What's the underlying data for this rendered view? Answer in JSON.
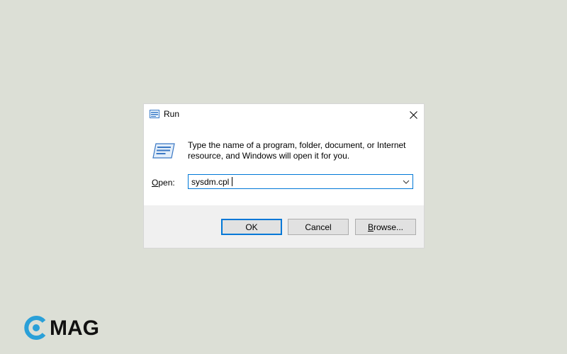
{
  "dialog": {
    "title": "Run",
    "icon": "run-icon",
    "close_icon": "close-icon",
    "description": "Type the name of a program, folder, document, or Internet resource, and Windows will open it for you.",
    "open_label_prefix": "",
    "open_label_underlined": "O",
    "open_label_rest": "pen:",
    "open_value": "sysdm.cpl",
    "buttons": {
      "ok": "OK",
      "cancel": "Cancel",
      "browse_underlined": "B",
      "browse_rest": "rowse..."
    }
  },
  "watermark": {
    "logo_icon": "cmag-logo-icon",
    "text": "MAG"
  },
  "colors": {
    "desktop": "#dcdfd6",
    "accent": "#0078d7",
    "footer": "#f0f0f0",
    "logo_blue": "#2aa0d8"
  }
}
